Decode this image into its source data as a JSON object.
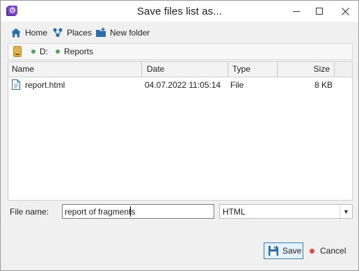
{
  "window": {
    "title": "Save files list as..."
  },
  "toolbar": {
    "home_label": "Home",
    "places_label": "Places",
    "new_folder_label": "New folder"
  },
  "breadcrumb": {
    "items": [
      "D:",
      "Reports"
    ]
  },
  "file_list": {
    "columns": [
      "Name",
      "Date",
      "Type",
      "Size"
    ],
    "rows": [
      {
        "name": "report.html",
        "date": "04.07.2022 11:05:14",
        "type": "File",
        "size": "8 KB"
      }
    ]
  },
  "file_name": {
    "label": "File name:",
    "value": "report of fragments"
  },
  "file_type": {
    "selected": "HTML"
  },
  "footer": {
    "save_label": "Save",
    "cancel_label": "Cancel"
  },
  "colors": {
    "accent": "#2b6fa8",
    "title_bar": "#ffffff",
    "dialog_bg": "#f0f0f0",
    "breadcrumb_dot": "#55a05f",
    "cancel_dot": "#d84a4a",
    "save_button_border": "#3c7fb1"
  },
  "icons": [
    "app-icon",
    "home-icon",
    "places-icon",
    "new-folder-icon",
    "drive-icon",
    "html-file-icon",
    "save-disk-icon",
    "cancel-icon",
    "chevron-down-icon",
    "minimize-icon",
    "maximize-icon",
    "close-icon"
  ]
}
